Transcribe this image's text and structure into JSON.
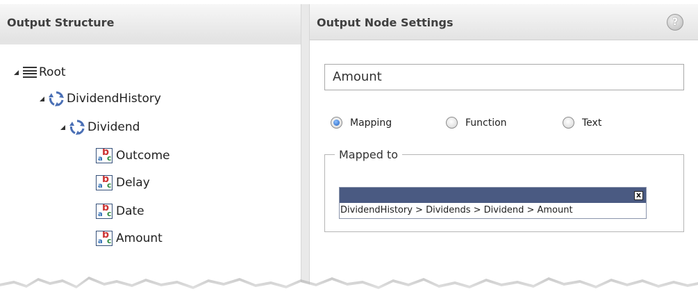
{
  "left_panel": {
    "title": "Output Structure",
    "tree": [
      {
        "label": "Root",
        "icon": "list-icon"
      },
      {
        "label": "DividendHistory",
        "icon": "cycle-icon"
      },
      {
        "label": "Dividend",
        "icon": "cycle-icon"
      },
      {
        "label": "Outcome",
        "icon": "string-type-icon"
      },
      {
        "label": "Delay",
        "icon": "string-type-icon"
      },
      {
        "label": "Date",
        "icon": "string-type-icon"
      },
      {
        "label": "Amount",
        "icon": "string-type-icon"
      }
    ]
  },
  "right_panel": {
    "title": "Output Node Settings",
    "help_icon": "?",
    "node_name_value": "Amount",
    "radios": [
      {
        "label": "Mapping",
        "checked": true
      },
      {
        "label": "Function",
        "checked": false
      },
      {
        "label": "Text",
        "checked": false
      }
    ],
    "mapped_to": {
      "legend": "Mapped to",
      "close_label": "x",
      "path": "DividendHistory > Dividends > Dividend > Amount"
    }
  },
  "colors": {
    "header_bg": "#e6e6e6",
    "mapped_bar": "#4a5a82",
    "radio_selected": "#1f5fbf"
  }
}
